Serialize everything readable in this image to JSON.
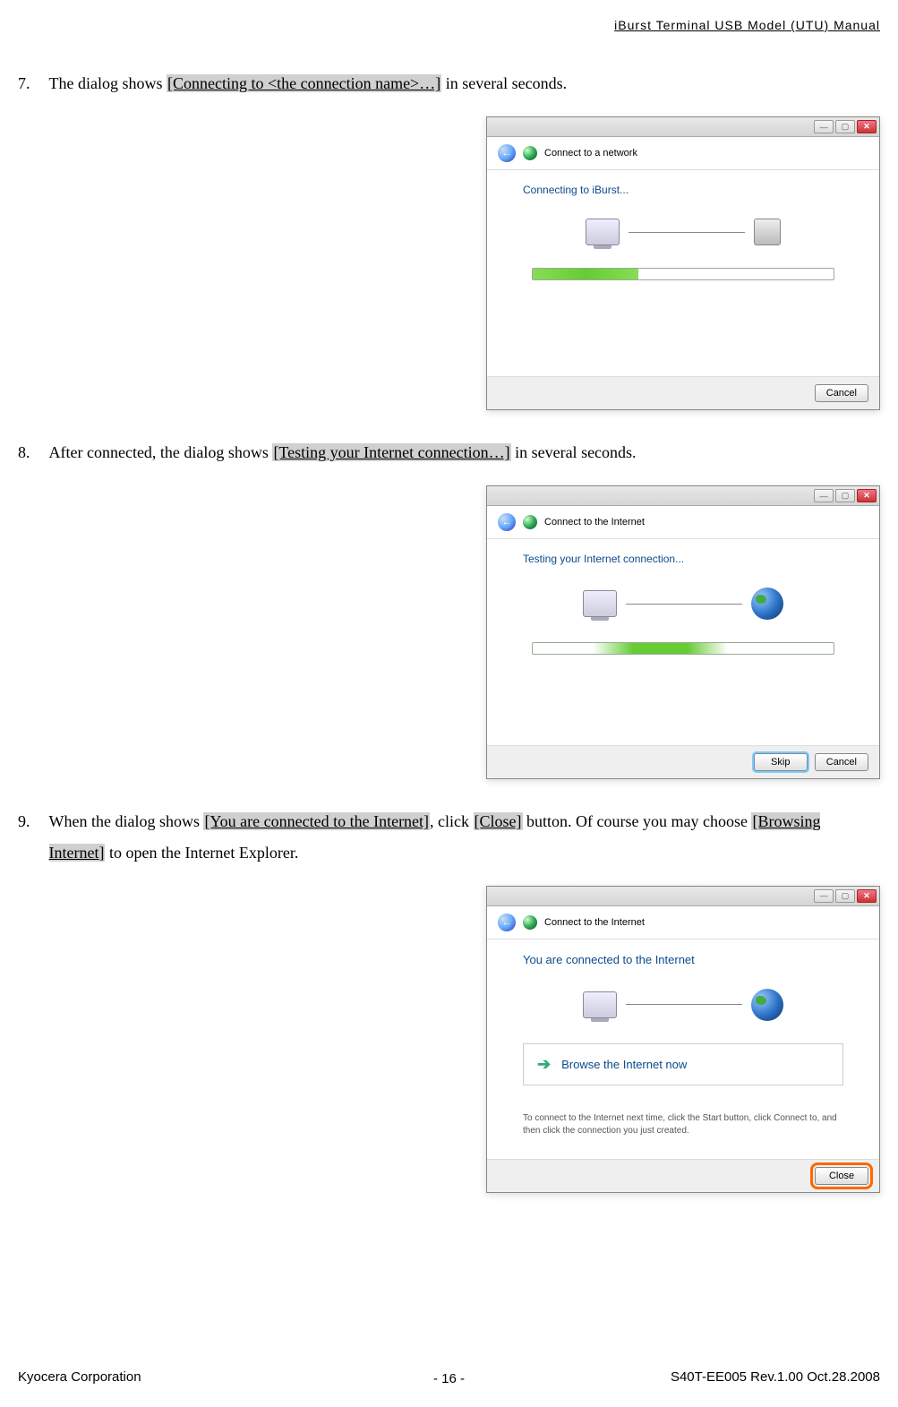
{
  "header": {
    "doc_title": "iBurst  Terminal  USB  Model  (UTU)  Manual"
  },
  "steps": {
    "s7": {
      "num": "7.",
      "pre": "The dialog shows ",
      "hl": "[Connecting to <the connection name>…]",
      "post": " in several seconds."
    },
    "s8": {
      "num": "8.",
      "pre": "After connected, the dialog shows ",
      "hl": "[Testing your Internet connection…]",
      "post": " in several seconds."
    },
    "s9": {
      "num": "9.",
      "pre": "When the dialog shows ",
      "hl1": "[You are connected to the Internet]",
      "mid1": ", click ",
      "hl2": "[Close]",
      "mid2": " button.    Of course you may choose ",
      "hl3": "[Browsing Internet]",
      "post": " to open the Internet Explorer."
    }
  },
  "dlg1": {
    "head": "Connect to a network",
    "msg": "Connecting to iBurst...",
    "cancel": "Cancel"
  },
  "dlg2": {
    "head": "Connect to the Internet",
    "msg": "Testing your Internet connection...",
    "skip": "Skip",
    "cancel": "Cancel"
  },
  "dlg3": {
    "head": "Connect to the Internet",
    "msg": "You are connected to the Internet",
    "browse": "Browse the Internet now",
    "helper": "To connect to the Internet next time, click the Start button, click Connect to, and then click the connection you just created.",
    "close": "Close"
  },
  "footer": {
    "left": "Kyocera Corporation",
    "right": "S40T-EE005 Rev.1.00 Oct.28.2008",
    "page": "- 16 -"
  }
}
